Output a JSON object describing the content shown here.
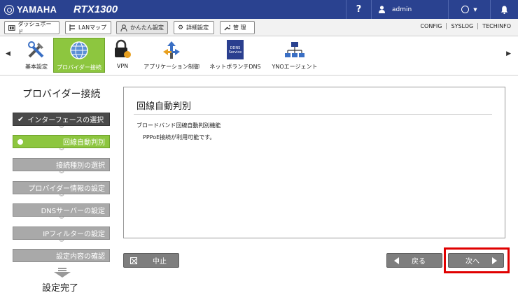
{
  "header": {
    "brand": "YAMAHA",
    "model": "RTX1300",
    "help": "?",
    "user": "admin",
    "status_icon": "status-circle-icon",
    "bell_icon": "bell-icon"
  },
  "nav": {
    "tabs": [
      {
        "label": "ダッシュボード",
        "icon": "dashboard-icon"
      },
      {
        "label": "LANマップ",
        "icon": "lanmap-icon"
      },
      {
        "label": "かんたん設定",
        "icon": "wizard-icon"
      },
      {
        "label": "詳細設定",
        "icon": "gear-icon"
      },
      {
        "label": "管 理",
        "icon": "wrench-icon"
      }
    ],
    "links": [
      "CONFIG",
      "SYSLOG",
      "TECHINFO"
    ]
  },
  "functions": [
    {
      "label": "基本設定",
      "icon": "tools-icon"
    },
    {
      "label": "プロバイダー接続",
      "icon": "globe-icon"
    },
    {
      "label": "VPN",
      "icon": "lock-icon"
    },
    {
      "label": "アプリケーション制御",
      "icon": "app-control-icon"
    },
    {
      "label": "ネットボランチDNS",
      "icon": "ddns-icon"
    },
    {
      "label": "YNOエージェント",
      "icon": "network-icon"
    }
  ],
  "ddns_badge": "DDNS Service",
  "wizard": {
    "title": "プロバイダー接続",
    "steps": [
      {
        "label": "インターフェースの選択",
        "state": "done"
      },
      {
        "label": "回線自動判別",
        "state": "current"
      },
      {
        "label": "接続種別の選択",
        "state": "pending"
      },
      {
        "label": "プロバイダー情報の設定",
        "state": "pending"
      },
      {
        "label": "DNSサーバーの設定",
        "state": "pending"
      },
      {
        "label": "IPフィルターの設定",
        "state": "pending"
      },
      {
        "label": "設定内容の確認",
        "state": "pending"
      }
    ],
    "final": "設定完了"
  },
  "panel": {
    "title": "回線自動判別",
    "subtitle": "ブロードバンド回線自動判別機能",
    "message": "PPPoE接続が利用可能です。"
  },
  "buttons": {
    "cancel": "中止",
    "back": "戻る",
    "next": "次へ"
  },
  "colors": {
    "header_bg": "#2a4290",
    "accent_green": "#8dc63f",
    "highlight_red": "#e00000"
  }
}
